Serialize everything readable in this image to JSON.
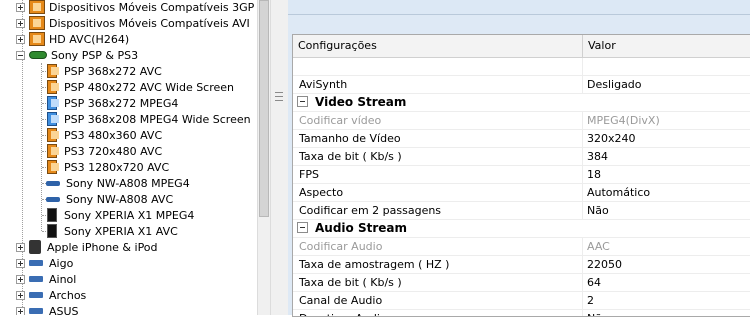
{
  "tree": {
    "items": [
      {
        "label": "Dispositivos Móveis Compatíveis 3GP",
        "icon": "film-icon",
        "expander": "plus"
      },
      {
        "label": "Dispositivos Móveis Compatíveis AVI",
        "icon": "film-icon",
        "expander": "plus"
      },
      {
        "label": "HD AVC(H264)",
        "icon": "film-icon",
        "expander": "plus"
      },
      {
        "label": "Sony PSP & PS3",
        "icon": "psp-icon",
        "expander": "minus"
      },
      {
        "label": "PSP 368x272 AVC",
        "icon": "film-icon"
      },
      {
        "label": "PSP 480x272 AVC Wide Screen",
        "icon": "film-icon"
      },
      {
        "label": "PSP 368x272 MPEG4",
        "icon": "film-blue-icon"
      },
      {
        "label": "PSP 368x208 MPEG4 Wide Screen",
        "icon": "film-blue-icon"
      },
      {
        "label": "PS3 480x360 AVC",
        "icon": "film-icon"
      },
      {
        "label": "PS3 720x480 AVC",
        "icon": "film-icon"
      },
      {
        "label": "PS3 1280x720 AVC",
        "icon": "film-icon"
      },
      {
        "label": "Sony NW-A808 MPEG4",
        "icon": "walkman-icon"
      },
      {
        "label": "Sony NW-A808 AVC",
        "icon": "walkman-icon"
      },
      {
        "label": "Sony XPERIA X1 MPEG4",
        "icon": "phone-icon"
      },
      {
        "label": "Sony XPERIA X1 AVC",
        "icon": "phone-icon"
      },
      {
        "label": "Apple iPhone & iPod",
        "icon": "iphone-icon",
        "expander": "plus"
      },
      {
        "label": "Aigo",
        "icon": "device-icon",
        "expander": "plus"
      },
      {
        "label": "Ainol",
        "icon": "device-icon",
        "expander": "plus"
      },
      {
        "label": "Archos",
        "icon": "device-icon",
        "expander": "plus"
      },
      {
        "label": "ASUS",
        "icon": "device-icon",
        "expander": "plus"
      }
    ]
  },
  "grid": {
    "headers": [
      "Configurações",
      "Valor"
    ],
    "rows": [
      {
        "type": "blank",
        "name": "",
        "value": ""
      },
      {
        "type": "row",
        "name": "AviSynth",
        "value": "Desligado"
      },
      {
        "type": "cat",
        "name": "Video Stream"
      },
      {
        "type": "row",
        "name": "Codificar vídeo",
        "value": "MPEG4(DivX)",
        "disabled": true
      },
      {
        "type": "row",
        "name": "Tamanho de Vídeo",
        "value": "320x240"
      },
      {
        "type": "row",
        "name": "Taxa de bit ( Kb/s )",
        "value": "384"
      },
      {
        "type": "row",
        "name": "FPS",
        "value": "18"
      },
      {
        "type": "row",
        "name": "Aspecto",
        "value": "Automático"
      },
      {
        "type": "row",
        "name": "Codificar em 2 passagens",
        "value": "Não"
      },
      {
        "type": "cat",
        "name": "Audio Stream"
      },
      {
        "type": "row",
        "name": "Codificar Audio",
        "value": "AAC",
        "disabled": true
      },
      {
        "type": "row",
        "name": "Taxa de amostragem ( HZ )",
        "value": "22050"
      },
      {
        "type": "row",
        "name": "Taxa de bit ( Kb/s )",
        "value": "64"
      },
      {
        "type": "row",
        "name": "Canal de Audio",
        "value": "2"
      },
      {
        "type": "row",
        "name": "Desativar Audio",
        "value": "Não"
      }
    ]
  },
  "colors": {
    "panel_bg": "#dee9f5",
    "film_orange": "#e5891a",
    "film_blue": "#3f8fe0",
    "disabled_text": "#9a9a9a"
  }
}
